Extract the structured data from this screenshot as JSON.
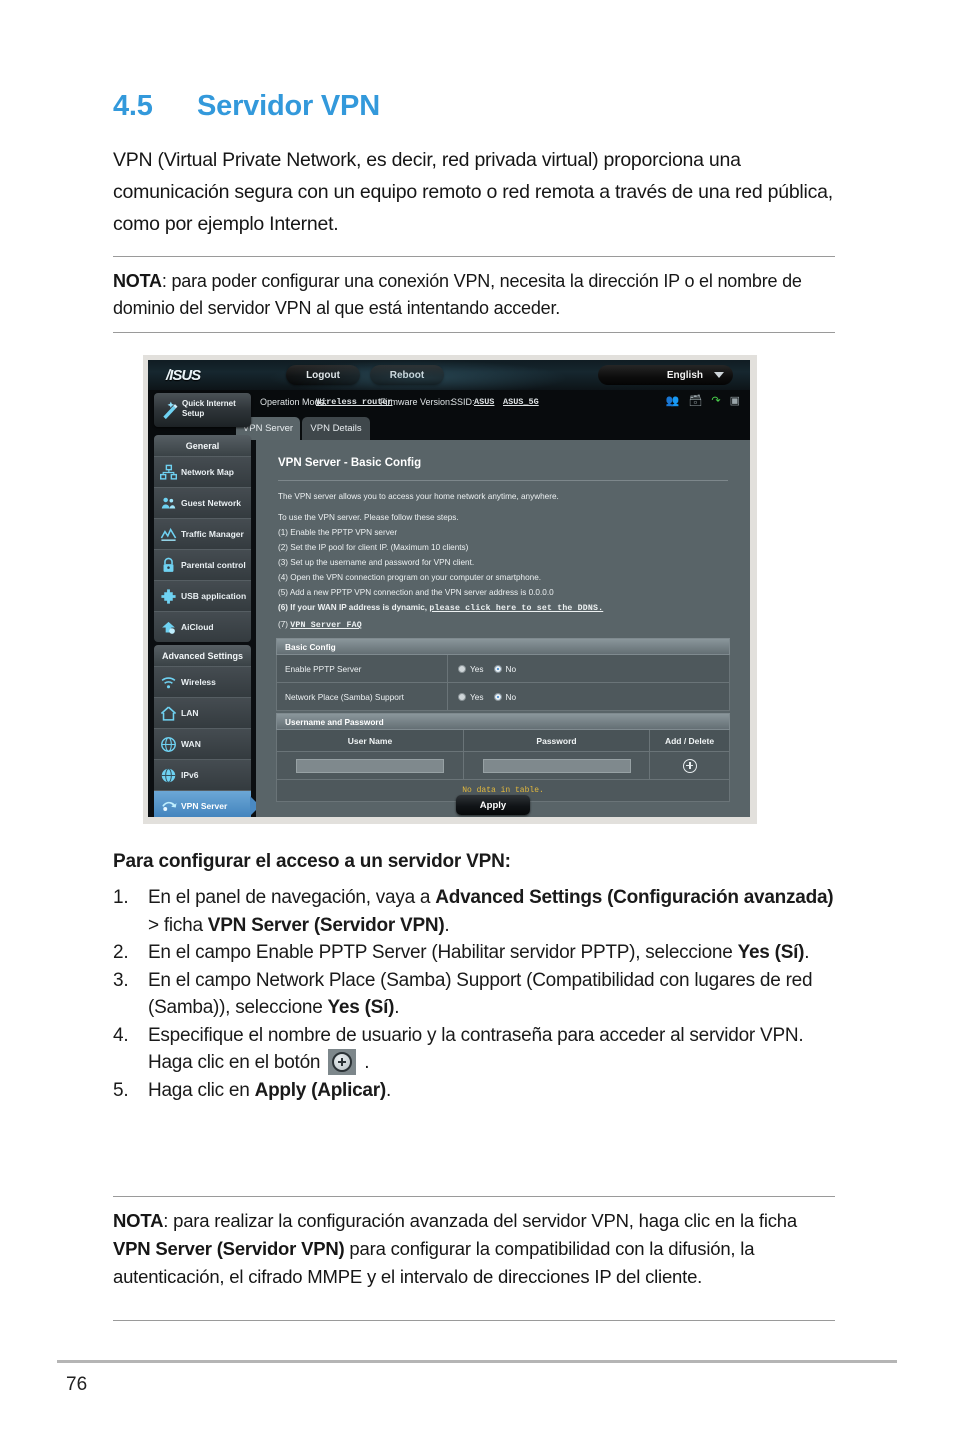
{
  "document": {
    "section_number": "4.5",
    "section_title": "Servidor VPN",
    "intro": "VPN (Virtual Private Network, es decir, red privada virtual) proporciona una comunicación segura con un equipo remoto o red remota a través de una red pública, como por ejemplo Internet.",
    "note_top": {
      "label": "NOTA",
      "text": ":  para poder configurar una conexión VPN, necesita la dirección IP o el nombre de dominio del servidor VPN al que está intentando acceder."
    },
    "steps_title": "Para configurar el acceso a un servidor VPN:",
    "steps": [
      {
        "number": "1.",
        "parts": [
          {
            "t": "En el panel de navegación, vaya a ",
            "b": false
          },
          {
            "t": "Advanced Settings (Configuración avanzada)",
            "b": true
          },
          {
            "t": " > ficha ",
            "b": false
          },
          {
            "t": "VPN Server (Servidor VPN)",
            "b": true
          },
          {
            "t": ".",
            "b": false
          }
        ]
      },
      {
        "number": "2.",
        "parts": [
          {
            "t": "En el campo Enable PPTP Server (Habilitar servidor PPTP), seleccione ",
            "b": false
          },
          {
            "t": "Yes (Sí)",
            "b": true
          },
          {
            "t": ".",
            "b": false
          }
        ]
      },
      {
        "number": "3.",
        "parts": [
          {
            "t": "En el campo Network Place (Samba) Support (Compatibilidad con lugares de red (Samba)), seleccione ",
            "b": false
          },
          {
            "t": "Yes (Sí)",
            "b": true
          },
          {
            "t": ".",
            "b": false
          }
        ]
      },
      {
        "number": "4.",
        "parts": [
          {
            "t": "Especifique el nombre de usuario y la contraseña para acceder al servidor VPN. Haga clic en el botón ",
            "b": false
          },
          {
            "icon": "add-circle-button"
          },
          {
            "t": " .",
            "b": false
          }
        ]
      },
      {
        "number": "5.",
        "parts": [
          {
            "t": "Haga clic en ",
            "b": false
          },
          {
            "t": "Apply (Aplicar)",
            "b": true
          },
          {
            "t": ".",
            "b": false
          }
        ]
      }
    ],
    "note_bottom": {
      "label": "NOTA",
      "parts": [
        {
          "t": ":  para realizar la configuración avanzada del servidor VPN, haga clic en la ficha ",
          "b": false
        },
        {
          "t": "VPN Server (Servidor VPN)",
          "b": true
        },
        {
          "t": " para configurar la compatibilidad con la difusión, la autenticación, el cifrado MMPE y el intervalo de direcciones IP del cliente.",
          "b": false
        }
      ]
    },
    "page_number": "76"
  },
  "router_ui": {
    "brand": "/ISUS",
    "top_buttons": [
      {
        "label": "Logout",
        "name": "logout-button"
      },
      {
        "label": "Reboot",
        "name": "reboot-button"
      }
    ],
    "language": {
      "label": "English",
      "caret": "chevron-down-icon"
    },
    "info_bar": {
      "operation_mode_label": "Operation Mode:",
      "operation_mode_value": "Wireless router",
      "firmware_label": "Firmware Version:",
      "firmware_value": "",
      "ssid_label": "SSID:",
      "ssid_value_1": "ASUS",
      "ssid_value_2": "ASUS_5G",
      "status_icons": [
        "guest-network-icon",
        "copy-icon",
        "usb-icon",
        "monitor-icon"
      ]
    },
    "tabs": [
      {
        "label": "VPN Server",
        "active": true
      },
      {
        "label": "VPN Details",
        "active": false
      }
    ],
    "quick_setup": {
      "line1": "Quick Internet",
      "line2": "Setup",
      "icon": "magic-wand-icon"
    },
    "nav_groups": [
      {
        "header": "General",
        "items": [
          {
            "label": "Network Map",
            "icon": "network-map-icon",
            "selected": false
          },
          {
            "label": "Guest Network",
            "icon": "guest-network-icon",
            "selected": false
          },
          {
            "label": "Traffic Manager",
            "icon": "traffic-manager-icon",
            "selected": false
          },
          {
            "label": "Parental control",
            "icon": "lock-icon",
            "selected": false
          },
          {
            "label": "USB application",
            "icon": "usb-application-icon",
            "selected": false
          },
          {
            "label": "AiCloud",
            "icon": "cloud-icon",
            "selected": false
          }
        ]
      },
      {
        "header": "Advanced Settings",
        "items": [
          {
            "label": "Wireless",
            "icon": "wifi-icon",
            "selected": false
          },
          {
            "label": "LAN",
            "icon": "home-icon",
            "selected": false
          },
          {
            "label": "WAN",
            "icon": "globe-icon",
            "selected": false
          },
          {
            "label": "IPv6",
            "icon": "ipv6-globe-icon",
            "selected": false
          },
          {
            "label": "VPN Server",
            "icon": "vpn-icon",
            "selected": true
          }
        ]
      }
    ],
    "content": {
      "title": "VPN Server - Basic Config",
      "description": "The VPN server allows you to access your home network anytime, anywhere.",
      "steps_intro": "To use the VPN server. Please follow these steps.",
      "steps": [
        "(1) Enable the PPTP VPN server",
        "(2) Set the IP pool for client IP. (Maximum 10 clients)",
        "(3) Set up the username and password for VPN client.",
        "(4) Open the VPN connection program on your computer or smartphone.",
        "(5) Add a new PPTP VPN connection and the VPN server address is 0.0.0.0"
      ],
      "step6_prefix": "(6) If your WAN IP address is dynamic, ",
      "step6_link": "please click here to set the DDNS.",
      "step7_prefix": "(7) ",
      "step7_link": "VPN Server FAQ",
      "basic_config": {
        "header": "Basic Config",
        "rows": [
          {
            "label": "Enable PPTP Server",
            "yes_label": "Yes",
            "no_label": "No",
            "selected": "No"
          },
          {
            "label": "Network Place (Samba) Support",
            "yes_label": "Yes",
            "no_label": "No",
            "selected": "No"
          }
        ]
      },
      "credentials": {
        "header": "Username and Password",
        "columns": [
          "User Name",
          "Password",
          "Add / Delete"
        ],
        "username_value": "",
        "password_value": "",
        "add_icon": "add-circle-icon",
        "empty_message": "No data in table."
      },
      "apply_label": "Apply"
    }
  }
}
